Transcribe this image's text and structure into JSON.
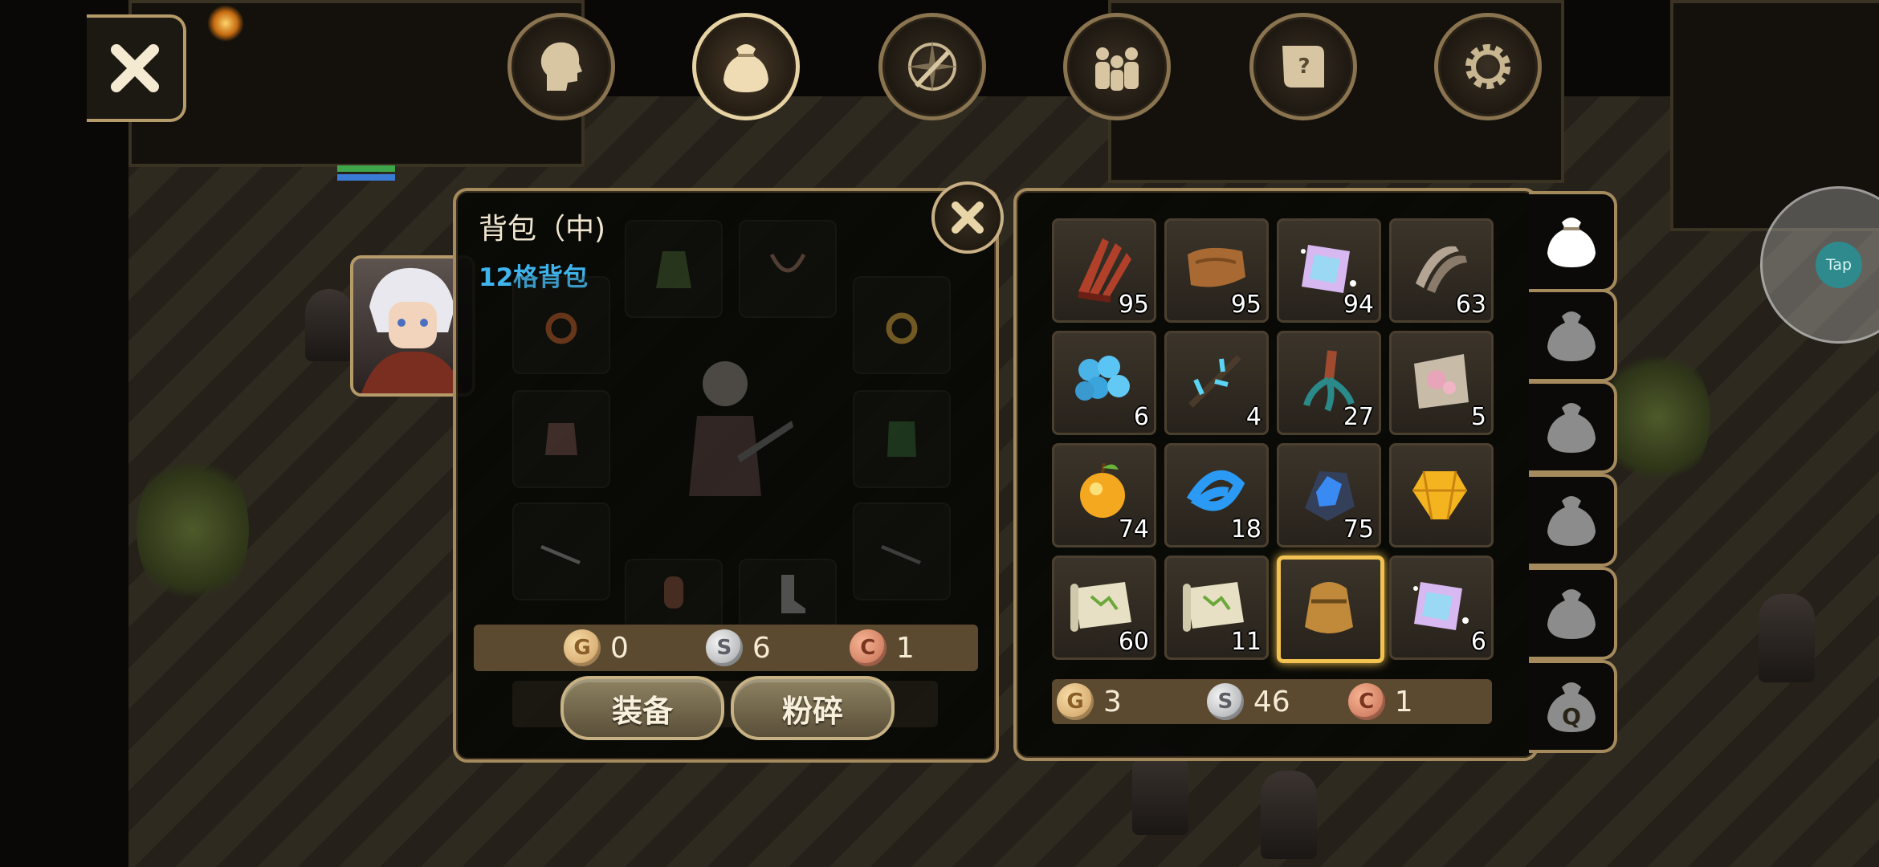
{
  "top_nav": {
    "icons": [
      "head-icon",
      "bag-icon",
      "compass-sword-icon",
      "party-icon",
      "quest-scroll-icon",
      "gear-icon"
    ],
    "active": "bag-icon"
  },
  "bag": {
    "title": "背包（中)",
    "subtitle": "12格背包",
    "currency": {
      "gold": "0",
      "silver": "6",
      "copper": "1"
    },
    "buttons": {
      "equip": "装备",
      "smash": "粉碎"
    }
  },
  "coins": {
    "gold_letter": "G",
    "silver_letter": "S",
    "copper_letter": "C"
  },
  "inventory": {
    "items": [
      {
        "name": "red-feather-bundle",
        "qty": "95"
      },
      {
        "name": "leather-hide",
        "qty": "95"
      },
      {
        "name": "crystal-card",
        "qty": "94"
      },
      {
        "name": "claws",
        "qty": "63"
      },
      {
        "name": "blue-eggs",
        "qty": "6"
      },
      {
        "name": "blue-branch",
        "qty": "4"
      },
      {
        "name": "teal-root",
        "qty": "27"
      },
      {
        "name": "pink-ore",
        "qty": "5"
      },
      {
        "name": "golden-apple",
        "qty": "74"
      },
      {
        "name": "blue-swirl",
        "qty": "18"
      },
      {
        "name": "blue-crystal-ore",
        "qty": "75"
      },
      {
        "name": "gold-gem",
        "qty": ""
      },
      {
        "name": "map-scroll",
        "qty": "60"
      },
      {
        "name": "map-scroll",
        "qty": "11"
      },
      {
        "name": "leather-bag",
        "qty": ""
      },
      {
        "name": "crystal-card",
        "qty": "6"
      }
    ],
    "currency": {
      "gold": "3",
      "silver": "46",
      "copper": "1"
    }
  },
  "bag_tabs": {
    "quest_letter": "Q"
  },
  "tap_button": {
    "label": "Tap"
  },
  "colors": {
    "frame": "#a48a5c",
    "subtitle_blue": "#3fb4ec",
    "selected_border": "#f2c350",
    "currency_bar": "#5c4a30"
  }
}
